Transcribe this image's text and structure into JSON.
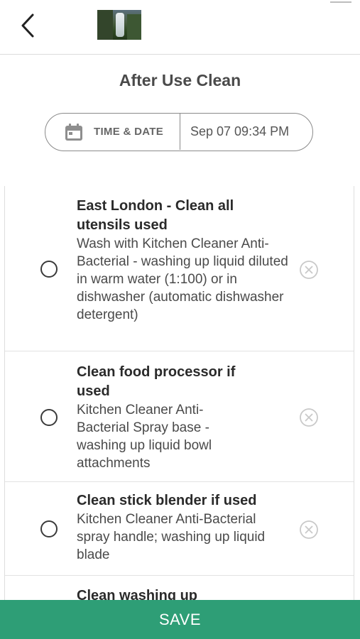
{
  "header": {
    "back_icon": "chevron-left-icon",
    "thumbnail": "waterfall-thumbnail"
  },
  "page": {
    "title": "After Use Clean"
  },
  "datetime": {
    "icon": "calendar-icon",
    "label": "TIME & DATE",
    "value": "Sep 07 09:34 PM"
  },
  "tasks": [
    {
      "title": "East London - Clean all utensils used",
      "description": "Wash with Kitchen Cleaner Anti-Bacterial  - washing up liquid diluted in warm water (1:100) or in dishwasher (automatic dishwasher detergent)"
    },
    {
      "title": "Clean food processor if used",
      "description": "Kitchen Cleaner Anti-Bacterial Spray base - washing up liquid bowl attachments"
    },
    {
      "title": "Clean stick blender if used",
      "description": "Kitchen Cleaner Anti-Bacterial spray handle; washing up liquid blade"
    },
    {
      "title": "Clean washing up",
      "description": ""
    }
  ],
  "footer": {
    "save_label": "SAVE"
  },
  "colors": {
    "accent": "#2e9e76",
    "text": "#2f2f2f",
    "muted_icon": "#c9c9c9"
  }
}
